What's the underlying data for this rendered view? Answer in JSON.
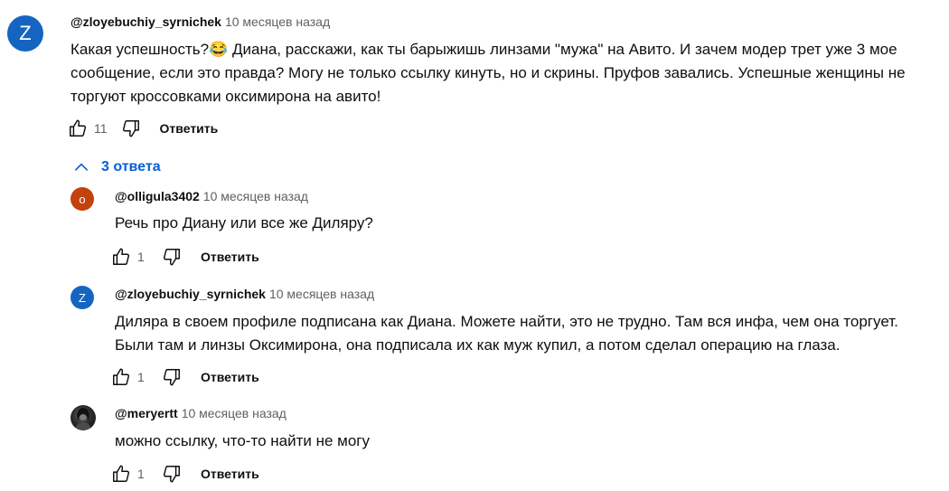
{
  "colors": {
    "avatar_z": "#1565c0",
    "avatar_o": "#c2410c",
    "link": "#065fd4"
  },
  "main_comment": {
    "avatar_letter": "Z",
    "author": "@zloyebuchiy_syrnichek",
    "time": "10 месяцев назад",
    "text_line1": "Какая успешность?😂 Диана, расскажи, как ты барыжишь линзами \"мужа\" на Авито. И зачем модер трет уже 3 мое",
    "text_line2": "сообщение, если это правда? Могу не только ссылку кинуть, но и скрины. Пруфов завались. Успешные женщины не",
    "text_line3": "торгуют кроссовками оксимирона на авито!",
    "likes": "11",
    "reply_label": "Ответить"
  },
  "replies_toggle": {
    "label": "3 ответа",
    "icon": "chevron-up-icon"
  },
  "replies": [
    {
      "avatar_letter": "o",
      "author": "@olligula3402",
      "time": "10 месяцев назад",
      "text_line1": "Речь про Диану или все же Диляру?",
      "likes": "1",
      "reply_label": "Ответить"
    },
    {
      "avatar_letter": "Z",
      "author": "@zloyebuchiy_syrnichek",
      "time": "10 месяцев назад",
      "text_line1": "Диляра в своем профиле подписана как Диана. Можете найти, это не трудно. Там вся инфа, чем она торгует.",
      "text_line2": "Были там и линзы Оксимирона, она подписала их как муж купил, а потом сделал операцию на глаза.",
      "likes": "1",
      "reply_label": "Ответить"
    },
    {
      "author": "@meryertt",
      "time": "10 месяцев назад",
      "text_line1": "можно ссылку, что-то найти не могу",
      "likes": "1",
      "reply_label": "Ответить"
    }
  ]
}
